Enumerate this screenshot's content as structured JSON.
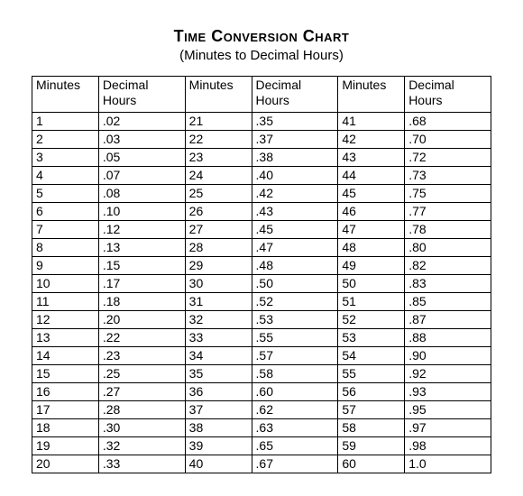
{
  "title": "Time Conversion Chart",
  "subtitle": "(Minutes to Decimal Hours)",
  "headers": {
    "minutes": "Minutes",
    "decimal_line1": "Decimal",
    "decimal_line2": "Hours"
  },
  "columns": [
    [
      {
        "min": "1",
        "dec": ".02"
      },
      {
        "min": "2",
        "dec": ".03"
      },
      {
        "min": "3",
        "dec": ".05"
      },
      {
        "min": "4",
        "dec": ".07"
      },
      {
        "min": "5",
        "dec": ".08"
      },
      {
        "min": "6",
        "dec": ".10"
      },
      {
        "min": "7",
        "dec": ".12"
      },
      {
        "min": "8",
        "dec": ".13"
      },
      {
        "min": "9",
        "dec": ".15"
      },
      {
        "min": "10",
        "dec": ".17"
      },
      {
        "min": "11",
        "dec": ".18"
      },
      {
        "min": "12",
        "dec": ".20"
      },
      {
        "min": "13",
        "dec": ".22"
      },
      {
        "min": "14",
        "dec": ".23"
      },
      {
        "min": "15",
        "dec": ".25"
      },
      {
        "min": "16",
        "dec": ".27"
      },
      {
        "min": "17",
        "dec": ".28"
      },
      {
        "min": "18",
        "dec": ".30"
      },
      {
        "min": "19",
        "dec": ".32"
      },
      {
        "min": "20",
        "dec": ".33"
      }
    ],
    [
      {
        "min": "21",
        "dec": ".35"
      },
      {
        "min": "22",
        "dec": ".37"
      },
      {
        "min": "23",
        "dec": ".38"
      },
      {
        "min": "24",
        "dec": ".40"
      },
      {
        "min": "25",
        "dec": ".42"
      },
      {
        "min": "26",
        "dec": ".43"
      },
      {
        "min": "27",
        "dec": ".45"
      },
      {
        "min": "28",
        "dec": ".47"
      },
      {
        "min": "29",
        "dec": ".48"
      },
      {
        "min": "30",
        "dec": ".50"
      },
      {
        "min": "31",
        "dec": ".52"
      },
      {
        "min": "32",
        "dec": ".53"
      },
      {
        "min": "33",
        "dec": ".55"
      },
      {
        "min": "34",
        "dec": ".57"
      },
      {
        "min": "35",
        "dec": ".58"
      },
      {
        "min": "36",
        "dec": ".60"
      },
      {
        "min": "37",
        "dec": ".62"
      },
      {
        "min": "38",
        "dec": ".63"
      },
      {
        "min": "39",
        "dec": ".65"
      },
      {
        "min": "40",
        "dec": ".67"
      }
    ],
    [
      {
        "min": "41",
        "dec": ".68"
      },
      {
        "min": "42",
        "dec": ".70"
      },
      {
        "min": "43",
        "dec": ".72"
      },
      {
        "min": "44",
        "dec": ".73"
      },
      {
        "min": "45",
        "dec": ".75"
      },
      {
        "min": "46",
        "dec": ".77"
      },
      {
        "min": "47",
        "dec": ".78"
      },
      {
        "min": "48",
        "dec": ".80"
      },
      {
        "min": "49",
        "dec": ".82"
      },
      {
        "min": "50",
        "dec": ".83"
      },
      {
        "min": "51",
        "dec": ".85"
      },
      {
        "min": "52",
        "dec": ".87"
      },
      {
        "min": "53",
        "dec": ".88"
      },
      {
        "min": "54",
        "dec": ".90"
      },
      {
        "min": "55",
        "dec": ".92"
      },
      {
        "min": "56",
        "dec": ".93"
      },
      {
        "min": "57",
        "dec": ".95"
      },
      {
        "min": "58",
        "dec": ".97"
      },
      {
        "min": "59",
        "dec": ".98"
      },
      {
        "min": "60",
        "dec": "1.0"
      }
    ]
  ]
}
